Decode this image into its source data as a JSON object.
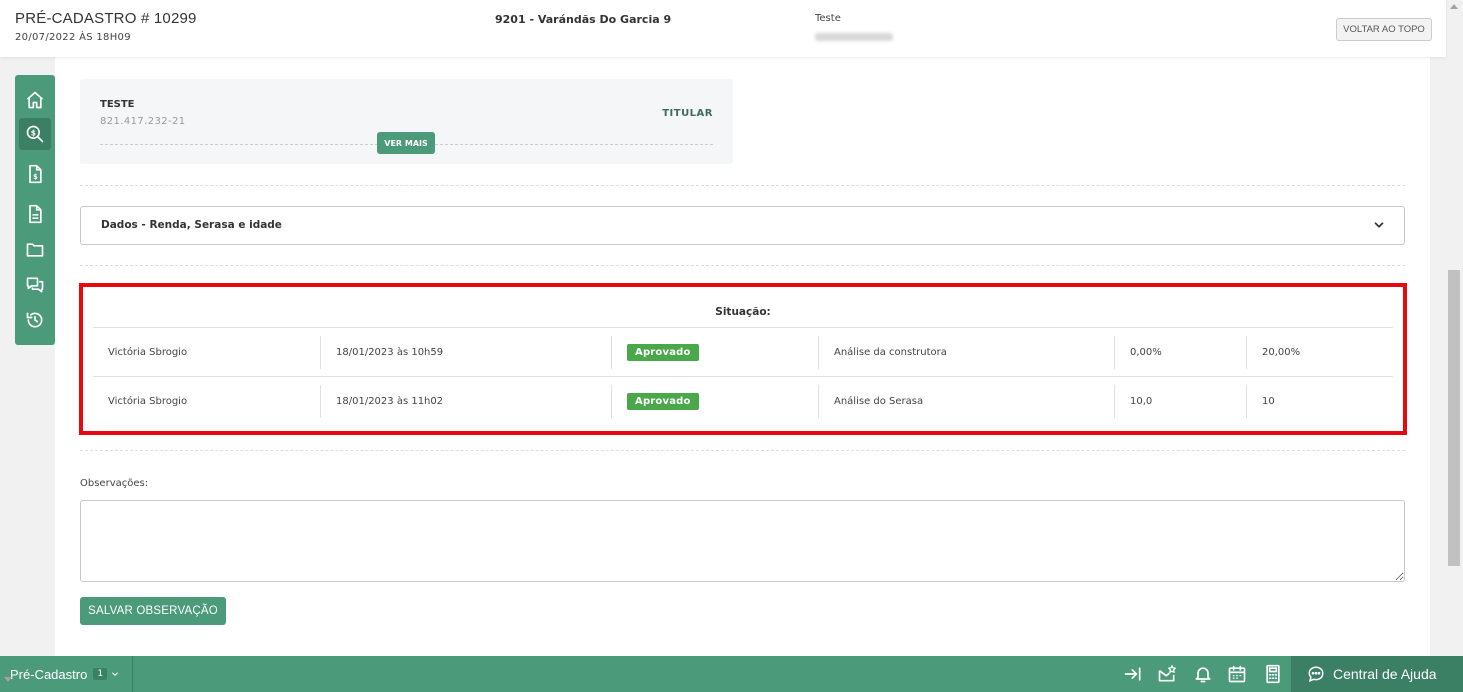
{
  "header": {
    "title": "PRÉ-CADASTRO # 10299",
    "date": "20/07/2022 ÀS 18H09",
    "project": "9201 - Varándãs Do Garcia 9",
    "client": "Teste",
    "back_to_top": "VOLTAR AO TOPO"
  },
  "sidebar": {
    "items": [
      {
        "icon": "home-icon",
        "active": false
      },
      {
        "icon": "search-dollar-icon",
        "active": true
      },
      {
        "icon": "invoice-icon",
        "active": false
      },
      {
        "icon": "document-icon",
        "active": false
      },
      {
        "icon": "folder-icon",
        "active": false
      },
      {
        "icon": "chat-icon",
        "active": false
      },
      {
        "icon": "history-icon",
        "active": false
      }
    ]
  },
  "holder": {
    "name": "TESTE",
    "cpf": "821.417.232-21",
    "role": "TITULAR",
    "more_label": "VER MAIS"
  },
  "accordion": {
    "label": "Dados - Renda, Serasa e idade"
  },
  "situation": {
    "title": "Situação:",
    "rows": [
      {
        "user": "Victória Sbrogio",
        "datetime": "18/01/2023 às 10h59",
        "status": "Aprovado",
        "analysis": "Análise da construtora",
        "value1": "0,00%",
        "value2": "20,00%"
      },
      {
        "user": "Victória Sbrogio",
        "datetime": "18/01/2023 às 11h02",
        "status": "Aprovado",
        "analysis": "Análise do Serasa",
        "value1": "10,0",
        "value2": "10"
      }
    ]
  },
  "observations": {
    "label": "Observações:",
    "value": "",
    "save_label": "SALVAR OBSERVAÇÃO"
  },
  "bottombar": {
    "tab_label": "Pré-Cadastro",
    "tab_count": "1",
    "help_label": "Central de Ajuda"
  },
  "colors": {
    "brand_green": "#4b9a7a",
    "brand_green_dark": "#3b8064",
    "approved_badge": "#4aa84a",
    "highlight_border": "#e8080f"
  }
}
